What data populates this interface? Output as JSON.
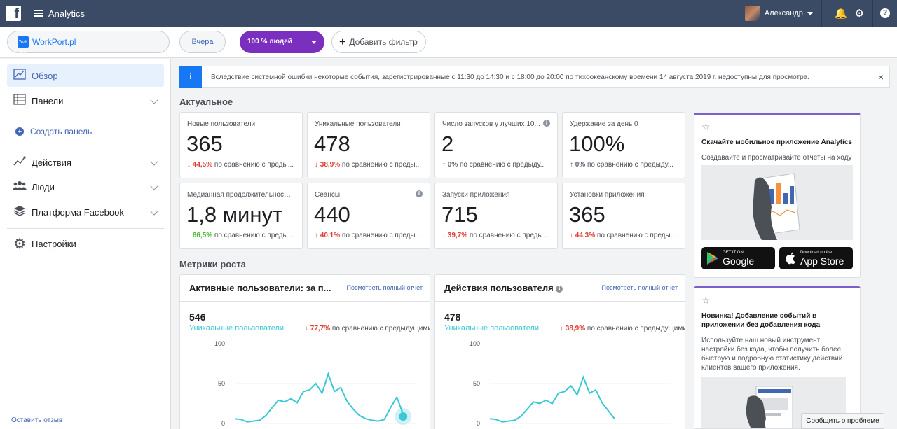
{
  "topbar": {
    "logo": "f",
    "app_title": "Analytics",
    "user_name": "Александр"
  },
  "filterbar": {
    "app_name": "WorkPort.pl",
    "app_logo_text": "Work Port",
    "date_button": "Вчера",
    "people_button": "100 % людей",
    "add_filter": "Добавить фильтр"
  },
  "sidebar": {
    "items": [
      {
        "label": "Обзор",
        "icon": "line-chart-icon"
      },
      {
        "label": "Панели",
        "icon": "panels-icon"
      },
      {
        "label": "Действия",
        "icon": "actions-icon"
      },
      {
        "label": "Люди",
        "icon": "people-icon"
      },
      {
        "label": "Платформа Facebook",
        "icon": "layers-icon"
      },
      {
        "label": "Настройки",
        "icon": "gear-icon"
      }
    ],
    "create_panel": "Создать панель",
    "feedback": "Оставить отзыв"
  },
  "notice": {
    "badge": "i",
    "text": "Вследствие системной ошибки некоторые события, зарегистрированные с 11:30 до 14:30 и с 18:00 до 20:00 по тихоокеанскому времени 14 августа 2019 г. недоступны для просмотра.",
    "close": "×"
  },
  "current": {
    "title": "Актуальное",
    "cards": [
      {
        "label": "Новые пользователи",
        "value": "365",
        "delta": "44,5%",
        "dir": "down",
        "delta_text": "по сравнению с преды..."
      },
      {
        "label": "Уникальные пользователи",
        "value": "478",
        "delta": "38,9%",
        "dir": "down",
        "delta_text": "по сравнению с преды..."
      },
      {
        "label": "Число запусков у лучших 10...",
        "value": "2",
        "delta": "0%",
        "dir": "flat",
        "delta_text": "по сравнению с предыду..."
      },
      {
        "label": "Удержание за день 0",
        "value": "100%",
        "delta": "0%",
        "dir": "flat",
        "delta_text": "по сравнению с предыду..."
      },
      {
        "label": "Медианная продолжительность...",
        "value": "1,8 минут",
        "delta": "66,5%",
        "dir": "up",
        "delta_text": "по сравнению с преды..."
      },
      {
        "label": "Сеансы",
        "value": "440",
        "delta": "40,1%",
        "dir": "down",
        "delta_text": "по сравнению с преды..."
      },
      {
        "label": "Запуски приложения",
        "value": "715",
        "delta": "39,7%",
        "dir": "down",
        "delta_text": "по сравнению с преды..."
      },
      {
        "label": "Установки приложения",
        "value": "365",
        "delta": "44,3%",
        "dir": "down",
        "delta_text": "по сравнению с преды..."
      }
    ]
  },
  "growth": {
    "title": "Метрики роста",
    "view_full": "Посмотреть полный отчет",
    "charts": [
      {
        "title": "Активные пользователи: за п...",
        "number": "546",
        "series_label": "Уникальные пользователи",
        "delta": "77,7%",
        "delta_text": "по сравнению с предыдущими",
        "y_ticks": [
          "100",
          "50",
          "0"
        ],
        "values": [
          6,
          5,
          2,
          3,
          4,
          10,
          20,
          29,
          27,
          31,
          26,
          40,
          42,
          50,
          38,
          62,
          40,
          45,
          28,
          18,
          10,
          6,
          4,
          3,
          5,
          20,
          33,
          12
        ]
      },
      {
        "title": "Действия пользователя",
        "number": "478",
        "series_label": "Уникальные пользователи",
        "delta": "38,9%",
        "delta_text": "по сравнению с предыдущими",
        "y_ticks": [
          "100",
          "50",
          "0"
        ],
        "values": [
          6,
          5,
          2,
          3,
          4,
          9,
          18,
          27,
          25,
          29,
          25,
          38,
          40,
          47,
          36,
          58,
          38,
          42,
          26,
          16,
          6
        ]
      }
    ]
  },
  "promos": [
    {
      "title": "Скачайте мобильное приложение Analytics",
      "text": "Создавайте и просматривайте отчеты на ходу",
      "google_small": "GET IT ON",
      "google_big": "Google Play",
      "apple_small": "Download on the",
      "apple_big": "App Store"
    },
    {
      "title": "Новинка! Добавление событий в приложении без добавления кода",
      "text": "Используйте наш новый инструмент настройки без кода, чтобы получить более быструю и подробную статистику действий клиентов вашего приложения."
    }
  ],
  "report_problem": "Сообщить о проблеме",
  "colors": {
    "accent": "#4267b2",
    "purple": "#7b2fbe",
    "series": "#3bc7d6",
    "down": "#e03c31",
    "up": "#42b72a"
  }
}
